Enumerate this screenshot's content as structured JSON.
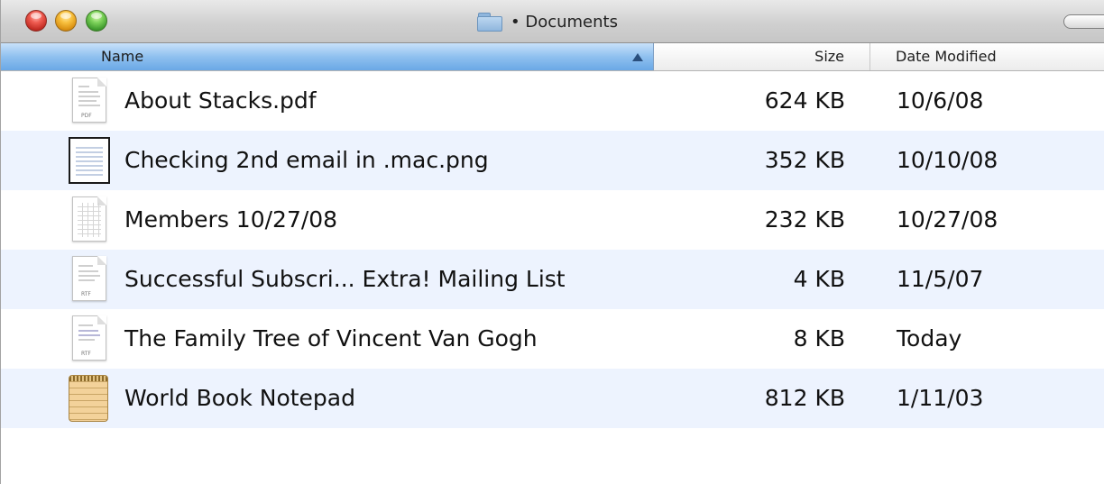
{
  "window": {
    "title": "• Documents"
  },
  "columns": {
    "name": "Name",
    "size": "Size",
    "date": "Date Modified",
    "sort_column": "name",
    "sort_direction": "ascending"
  },
  "files": [
    {
      "name": "About Stacks.pdf",
      "size": "624 KB",
      "date": "10/6/08",
      "icon": "pdf-document-icon",
      "icon_tag": "PDF"
    },
    {
      "name": "Checking 2nd email in .mac.png",
      "size": "352 KB",
      "date": "10/10/08",
      "icon": "png-image-icon"
    },
    {
      "name": "Members 10/27/08",
      "size": "232 KB",
      "date": "10/27/08",
      "icon": "spreadsheet-document-icon"
    },
    {
      "name": "Successful Subscri... Extra! Mailing List",
      "size": "4 KB",
      "date": "11/5/07",
      "icon": "rtf-document-icon",
      "icon_tag": "RTF"
    },
    {
      "name": "The Family Tree of Vincent Van Gogh",
      "size": "8 KB",
      "date": "Today",
      "icon": "rtf-document-icon",
      "icon_tag": "RTF"
    },
    {
      "name": "World Book Notepad",
      "size": "812 KB",
      "date": "1/11/03",
      "icon": "notepad-icon"
    }
  ],
  "colors": {
    "selected_header": "#8fc0ef",
    "alternate_row": "#edf3fe"
  }
}
